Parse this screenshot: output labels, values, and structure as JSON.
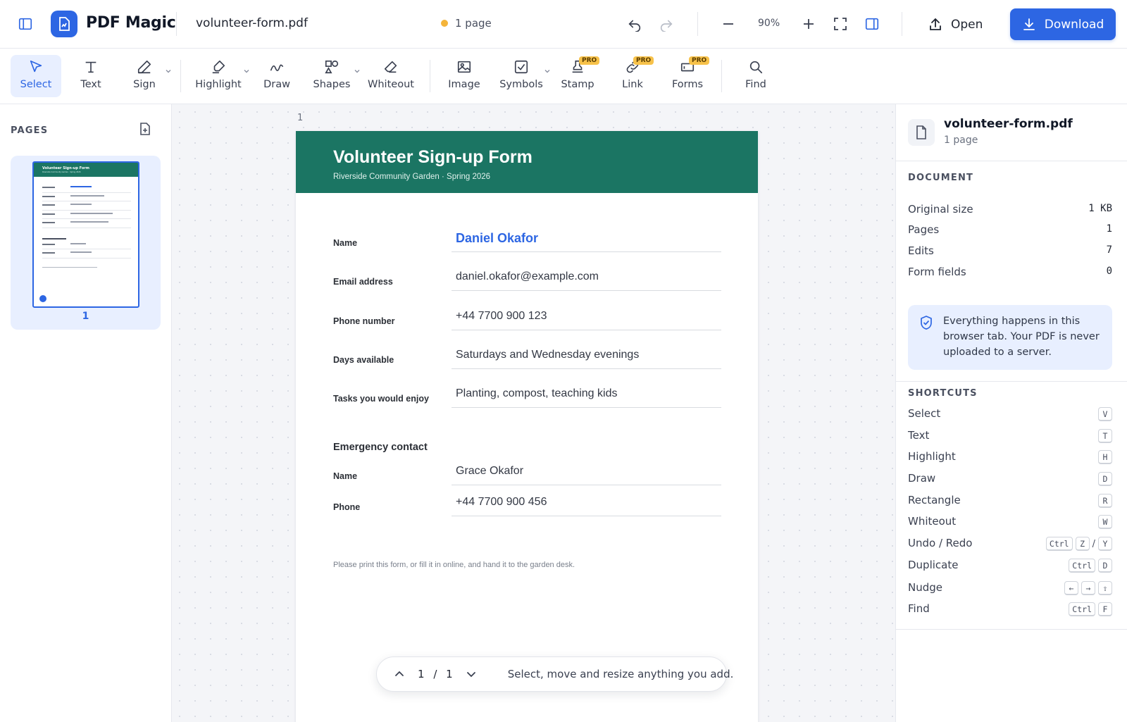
{
  "app": {
    "name": "PDF Magic",
    "filename": "volunteer-form.pdf",
    "page_count_label": "1 page",
    "zoom": "90%",
    "open_label": "Open",
    "download_label": "Download",
    "accent_color": "#2d66e3"
  },
  "toolbar": {
    "tools": [
      {
        "label": "Select",
        "icon": "pointer-icon",
        "active": true
      },
      {
        "label": "Text",
        "icon": "text-icon"
      },
      {
        "label": "Sign",
        "icon": "pen-icon",
        "dropdown": true
      },
      {
        "label": "Highlight",
        "icon": "highlighter-icon",
        "dropdown": true
      },
      {
        "label": "Draw",
        "icon": "squiggle-icon"
      },
      {
        "label": "Shapes",
        "icon": "shapes-icon",
        "dropdown": true
      },
      {
        "label": "Whiteout",
        "icon": "eraser-icon"
      },
      {
        "label": "Image",
        "icon": "image-icon"
      },
      {
        "label": "Symbols",
        "icon": "checkbox-icon",
        "dropdown": true
      },
      {
        "label": "Stamp",
        "icon": "stamp-icon",
        "pro": true
      },
      {
        "label": "Link",
        "icon": "link-icon",
        "pro": true
      },
      {
        "label": "Forms",
        "icon": "form-icon",
        "pro": true,
        "dropdown": true
      },
      {
        "label": "Find",
        "icon": "search-icon"
      }
    ],
    "pro_badge": "PRO"
  },
  "pages_panel": {
    "title": "PAGES",
    "thumbnails": [
      {
        "number": "1"
      }
    ]
  },
  "document": {
    "page_label": "1",
    "title": "Volunteer Sign-up Form",
    "subtitle": "Riverside Community Garden  ·  Spring 2026",
    "header_color": "#1b7563",
    "fields": [
      {
        "label": "Name",
        "value": "Daniel Okafor",
        "signature": true
      },
      {
        "label": "Email address",
        "value": "daniel.okafor@example.com"
      },
      {
        "label": "Phone number",
        "value": "+44 7700 900 123"
      },
      {
        "label": "Days available",
        "value": "Saturdays and Wednesday evenings"
      },
      {
        "label": "Tasks you would enjoy",
        "value": "Planting, compost, teaching kids"
      }
    ],
    "emergency_title": "Emergency contact",
    "emergency_fields": [
      {
        "label": "Name",
        "value": "Grace Okafor"
      },
      {
        "label": "Phone",
        "value": "+44 7700 900 456"
      }
    ],
    "footnote": "Please print this form, or fill it in online, and hand it to the garden desk."
  },
  "pager": {
    "current": "1",
    "separator": "/",
    "total": "1",
    "hint": "Select, move and resize anything you add."
  },
  "info_panel": {
    "filename": "volunteer-form.pdf",
    "pages_label": "1 page",
    "document_title": "DOCUMENT",
    "stats": [
      {
        "label": "Original size",
        "value": "1 KB"
      },
      {
        "label": "Pages",
        "value": "1"
      },
      {
        "label": "Edits",
        "value": "7"
      },
      {
        "label": "Form fields",
        "value": "0"
      }
    ],
    "privacy_text": "Everything happens in this browser tab. Your PDF is never uploaded to a server.",
    "shortcuts_title": "SHORTCUTS",
    "shortcuts": [
      {
        "label": "Select",
        "keys": [
          "V"
        ]
      },
      {
        "label": "Text",
        "keys": [
          "T"
        ]
      },
      {
        "label": "Highlight",
        "keys": [
          "H"
        ]
      },
      {
        "label": "Draw",
        "keys": [
          "D"
        ]
      },
      {
        "label": "Rectangle",
        "keys": [
          "R"
        ]
      },
      {
        "label": "Whiteout",
        "keys": [
          "W"
        ]
      },
      {
        "label": "Undo / Redo",
        "keys": [
          "Ctrl",
          "Z",
          "/",
          "Y"
        ]
      },
      {
        "label": "Duplicate",
        "keys": [
          "Ctrl",
          "D"
        ]
      },
      {
        "label": "Nudge",
        "keys": [
          "←",
          "→",
          "⇧"
        ]
      },
      {
        "label": "Find",
        "keys": [
          "Ctrl",
          "F"
        ]
      }
    ]
  }
}
